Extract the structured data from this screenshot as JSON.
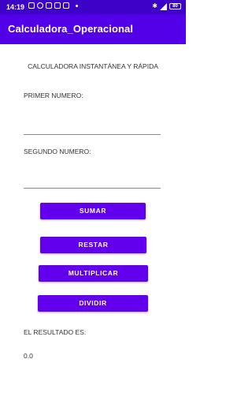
{
  "status_bar": {
    "time": "14:19",
    "battery_level": "80"
  },
  "app_bar": {
    "title": "Calculadora_Operacional"
  },
  "main": {
    "subtitle": "CALCULADORA INSTANTÁNEA Y RÁPIDA",
    "first_number_label": "PRIMER NUMERO:",
    "first_number_value": "",
    "second_number_label": "SEGUNDO NUMERO:",
    "second_number_value": "",
    "buttons": {
      "sum": "SUMAR",
      "subtract": "RESTAR",
      "multiply": "MULTIPLICAR",
      "divide": "DIVIDIR"
    },
    "result_label": "EL RESULTADO ES:",
    "result_value": "0.0"
  },
  "colors": {
    "status_bar": "#3d02c8",
    "app_bar": "#5200e8",
    "button": "#6200ee"
  }
}
